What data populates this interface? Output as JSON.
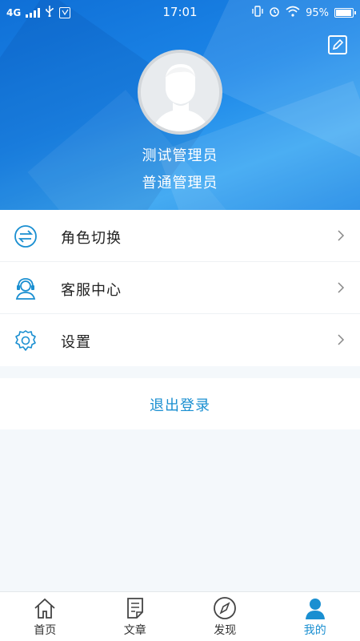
{
  "status_bar": {
    "network": "4G",
    "time": "17:01",
    "battery_percent": "95%",
    "battery_level": 0.95,
    "icons": [
      "signal-icon",
      "usb-icon",
      "notification-box-icon",
      "vibrate-icon",
      "alarm-icon",
      "wifi-icon",
      "battery-icon"
    ]
  },
  "profile": {
    "name": "测试管理员",
    "role": "普通管理员",
    "edit_icon": "edit-icon",
    "avatar_icon": "default-avatar-icon"
  },
  "menu": {
    "items": [
      {
        "label": "角色切换",
        "icon": "switch-icon"
      },
      {
        "label": "客服中心",
        "icon": "customer-service-icon"
      },
      {
        "label": "设置",
        "icon": "settings-gear-icon"
      }
    ]
  },
  "logout": {
    "label": "退出登录"
  },
  "tabbar": {
    "tabs": [
      {
        "label": "首页",
        "icon": "home-icon",
        "active": false
      },
      {
        "label": "文章",
        "icon": "article-icon",
        "active": false
      },
      {
        "label": "发现",
        "icon": "compass-icon",
        "active": false
      },
      {
        "label": "我的",
        "icon": "user-icon",
        "active": true
      }
    ]
  },
  "colors": {
    "accent": "#1a8fd1",
    "header_blue": "#1c86e8",
    "background": "#f4f8fb"
  }
}
